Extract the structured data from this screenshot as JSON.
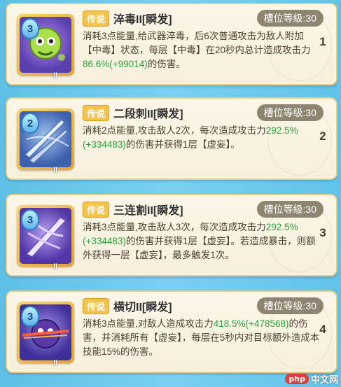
{
  "skills": [
    {
      "level": "3",
      "rarity": "传说",
      "name": "淬毒II[瞬发]",
      "slot_level": "槽位等级:30",
      "slot_number": "1",
      "roman": "II",
      "desc_a": "消耗3点能量,给武器淬毒，后6次普通攻击为敌人附加【中毒】状态，每层【中毒】在20秒内总计造成攻击力",
      "desc_green": "86.6%(+99014)",
      "desc_b": "的伤害。",
      "icon": "poison-skull-icon"
    },
    {
      "level": "2",
      "rarity": "传说",
      "name": "二段刺II[瞬发]",
      "slot_level": "槽位等级:30",
      "slot_number": "2",
      "roman": "II",
      "desc_a": "消耗2点能量,攻击敌人2次，每次造成攻击力",
      "desc_green": "292.5%(+334483)",
      "desc_b": "的伤害并获得1层【虚妄】。",
      "icon": "double-stab-icon"
    },
    {
      "level": "3",
      "rarity": "传说",
      "name": "三连割II[瞬发]",
      "slot_level": "槽位等级:30",
      "slot_number": "3",
      "roman": "II",
      "desc_a": "消耗3点能量,攻击敌人3次，每次造成攻击力",
      "desc_green": "292.5%(+334483)",
      "desc_b": "的伤害并获得1层【虚妄】。若造成暴击，则额外获得一层【虚妄】，最多触发1次。",
      "icon": "triple-cut-icon"
    },
    {
      "level": "3",
      "rarity": "传说",
      "name": "横切II[瞬发]",
      "slot_level": "槽位等级:30",
      "slot_number": "4",
      "roman": "II",
      "desc_a": "消耗3点能量,对敌人造成攻击力",
      "desc_green": "418.5%(+478568)",
      "desc_b": "的伤害，并消耗所有【虚妄】，每层在5秒内对目标额外造成本技能15%的伤害。",
      "icon": "horizontal-slash-icon"
    }
  ],
  "watermark": {
    "logo": "php",
    "text": "中文网"
  },
  "colors": {
    "rarity": "#f3c34a",
    "damage_green": "#27a33a",
    "slot_pill": "#8e8570",
    "card_bg": "#fbf6e8"
  }
}
